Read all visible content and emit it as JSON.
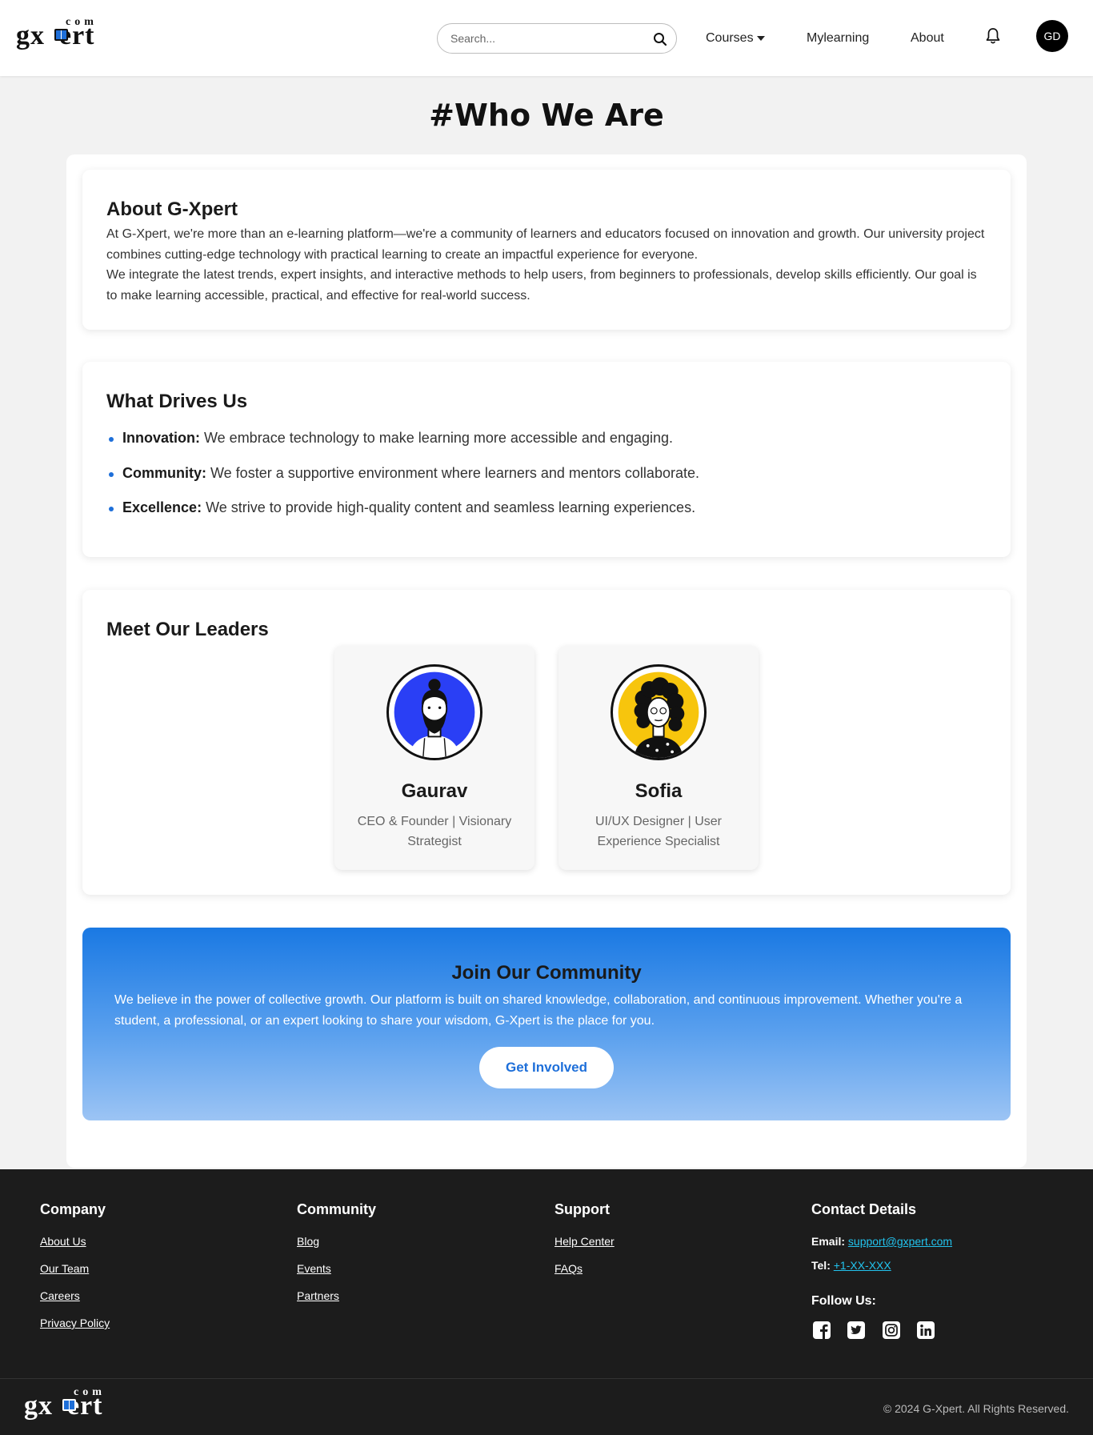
{
  "header": {
    "logo": {
      "left": "gx",
      "right": "ert",
      "superscript": "com"
    },
    "search": {
      "placeholder": "Search...",
      "value": ""
    },
    "nav": {
      "courses": "Courses",
      "mylearning": "Mylearning",
      "about": "About"
    },
    "avatar_initials": "GD"
  },
  "page_title": "#Who We Are",
  "about": {
    "title": "About G-Xpert",
    "paragraph_1": "At G-Xpert, we're more than an e-learning platform—we're a community of learners and educators focused on innovation and growth. Our university project combines cutting-edge technology with practical learning to create an impactful experience for everyone.",
    "paragraph_2": "We integrate the latest trends, expert insights, and interactive methods to help users, from beginners to professionals, develop skills efficiently. Our goal is to make learning accessible, practical, and effective for real-world success."
  },
  "drives": {
    "title": "What Drives Us",
    "items": [
      {
        "term": "Innovation:",
        "text": " We embrace technology to make learning more accessible and engaging."
      },
      {
        "term": "Community:",
        "text": " We foster a supportive environment where learners and mentors collaborate."
      },
      {
        "term": "Excellence:",
        "text": " We strive to provide high-quality content and seamless learning experiences."
      }
    ]
  },
  "leaders": {
    "title": "Meet Our Leaders",
    "people": [
      {
        "name": "Gaurav",
        "role": "CEO & Founder | Visionary Strategist",
        "bg_color": "#2a3ff5"
      },
      {
        "name": "Sofia",
        "role": "UI/UX Designer | User Experience Specialist",
        "bg_color": "#f7c50d"
      }
    ]
  },
  "join": {
    "title": "Join Our Community",
    "text": "We believe in the power of collective growth. Our platform is built on shared knowledge, collaboration, and continuous improvement. Whether you're a student, a professional, or an expert looking to share your wisdom, G-Xpert is the place for you.",
    "button": "Get Involved"
  },
  "footer": {
    "company": {
      "title": "Company",
      "links": [
        "About Us",
        "Our Team",
        "Careers",
        "Privacy Policy"
      ]
    },
    "community": {
      "title": "Community",
      "links": [
        "Blog",
        "Events",
        "Partners"
      ]
    },
    "support": {
      "title": "Support",
      "links": [
        "Help Center",
        "FAQs"
      ]
    },
    "contact": {
      "title": "Contact Details",
      "email_label": "Email:",
      "email": "support@gxpert.com",
      "tel_label": "Tel:",
      "tel": "+1-XX-XXX",
      "follow_label": "Follow Us:",
      "socials": [
        "facebook-icon",
        "twitter-icon",
        "instagram-icon",
        "linkedin-icon"
      ]
    },
    "copyright": "© 2024 G-Xpert. All Rights Reserved."
  },
  "colors": {
    "accent": "#1e6fd9",
    "footer_bg": "#1c1c1c",
    "link_cyan": "#22c3ee"
  }
}
